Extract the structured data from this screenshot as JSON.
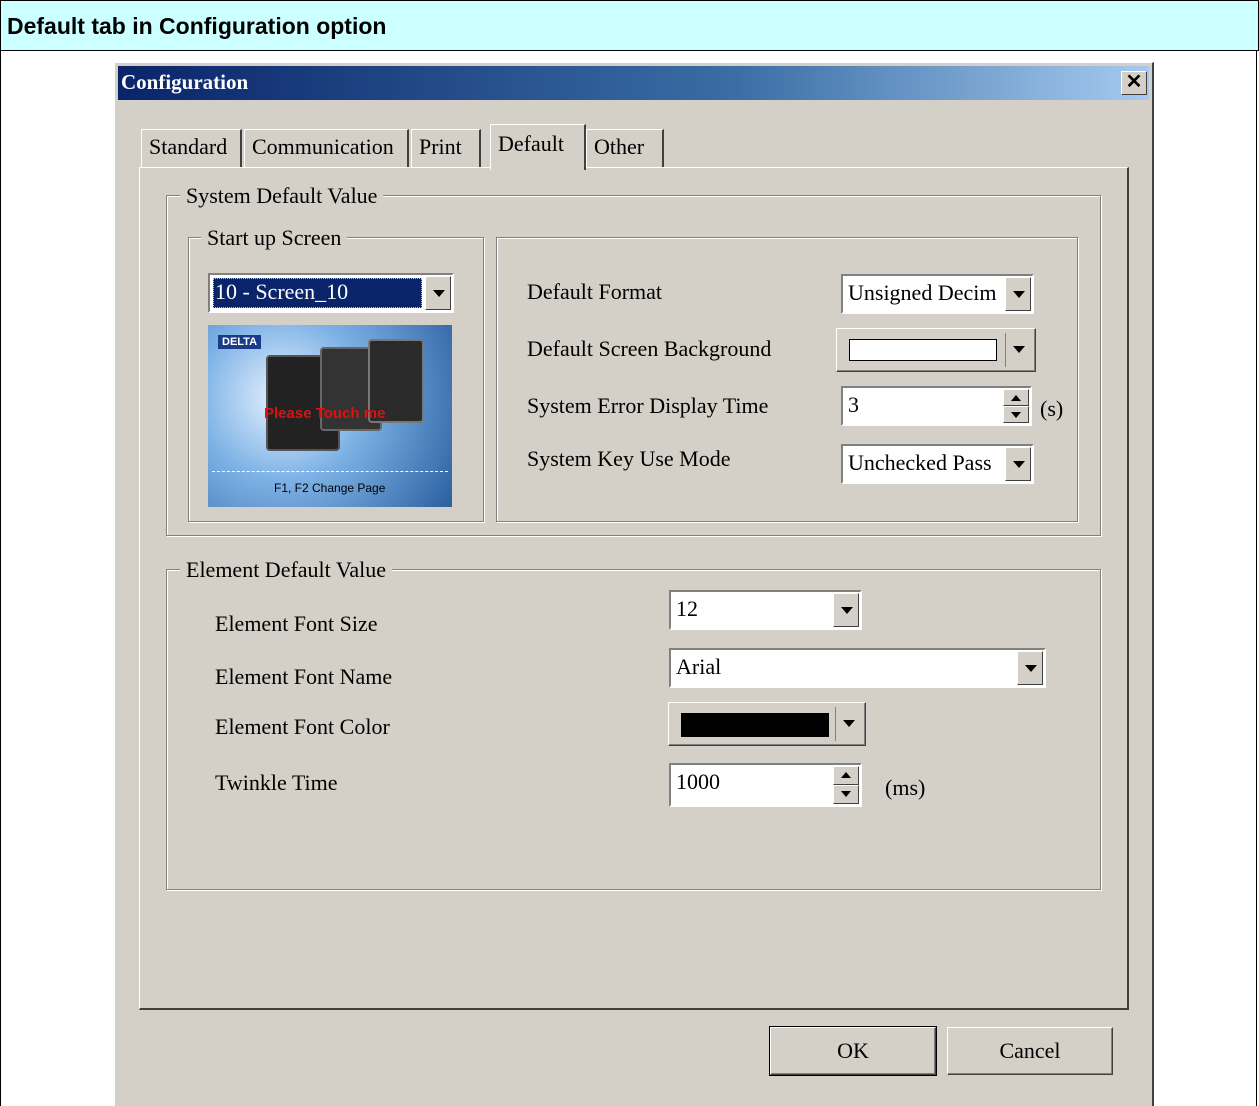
{
  "caption": "Default tab in Configuration option",
  "dialog": {
    "title": "Configuration",
    "close_glyph": "✕"
  },
  "tabs": [
    {
      "label": "Standard"
    },
    {
      "label": "Communication"
    },
    {
      "label": "Print"
    },
    {
      "label": "Default",
      "active": true
    },
    {
      "label": "Other"
    }
  ],
  "system_default": {
    "legend": "System Default Value",
    "startup": {
      "legend": "Start up Screen",
      "selected": "10 - Screen_10",
      "preview": {
        "brand": "DELTA",
        "banner": "Please Touch me",
        "footer": "F1, F2 Change Page"
      }
    },
    "default_format": {
      "label": "Default Format",
      "value": "Unsigned Decim"
    },
    "screen_background": {
      "label": "Default Screen Background",
      "color": "#ffffff"
    },
    "error_display_time": {
      "label": "System Error Display Time",
      "value": "3",
      "unit": "(s)"
    },
    "key_use_mode": {
      "label": "System Key Use Mode",
      "value": "Unchecked Pass"
    }
  },
  "element_default": {
    "legend": "Element Default Value",
    "font_size": {
      "label": "Element Font Size",
      "value": "12"
    },
    "font_name": {
      "label": "Element Font Name",
      "value": "Arial"
    },
    "font_color": {
      "label": "Element Font Color",
      "color": "#000000"
    },
    "twinkle_time": {
      "label": "Twinkle Time",
      "value": "1000",
      "unit": "(ms)"
    }
  },
  "buttons": {
    "ok": "OK",
    "cancel": "Cancel"
  },
  "colors": {
    "caption_bg": "#ccffff",
    "dialog_bg": "#d4d0c8",
    "title_start": "#0a246a",
    "title_end": "#a6caf0",
    "selection": "#0a246a"
  }
}
